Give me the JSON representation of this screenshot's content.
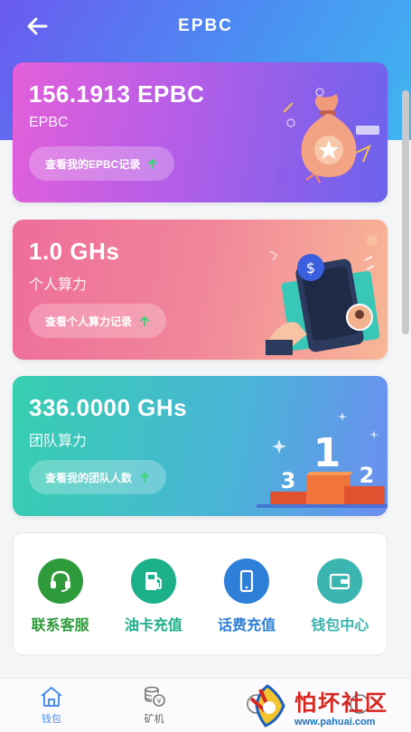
{
  "header": {
    "title": "EPBC",
    "back_icon": "arrow-left-icon"
  },
  "cards": [
    {
      "value": "156.1913 EPBC",
      "label": "EPBC",
      "button_label": "查看我的EPBC记录",
      "illustration": "money-bag-icon"
    },
    {
      "value": "1.0 GHs",
      "label": "个人算力",
      "button_label": "查看个人算力记录",
      "illustration": "phone-in-hand-icon"
    },
    {
      "value": "336.0000 GHs",
      "label": "团队算力",
      "button_label": "查看我的团队人数",
      "illustration": "podium-icon"
    }
  ],
  "menu": [
    {
      "label": "联系客服",
      "icon": "headset-icon",
      "color": "#2e9a3a"
    },
    {
      "label": "油卡充值",
      "icon": "fuel-pump-icon",
      "color": "#1bb08a"
    },
    {
      "label": "话费充值",
      "icon": "mobile-phone-icon",
      "color": "#2e7fd8"
    },
    {
      "label": "钱包中心",
      "icon": "wallet-icon",
      "color": "#3bb5b0"
    }
  ],
  "tabs": [
    {
      "label": "钱包",
      "icon": "home-icon",
      "active": true
    },
    {
      "label": "矿机",
      "icon": "coins-icon",
      "active": false
    },
    {
      "label": "",
      "icon": "team-icon",
      "active": false
    },
    {
      "label": "",
      "icon": "user-icon",
      "active": false
    }
  ],
  "watermark": {
    "cn": "怕坏社区",
    "url": "www.pahuai.com"
  },
  "colors": {
    "header_gradient_start": "#6a5af0",
    "header_gradient_end": "#3fb6f0",
    "tab_active": "#4a8ef2"
  }
}
